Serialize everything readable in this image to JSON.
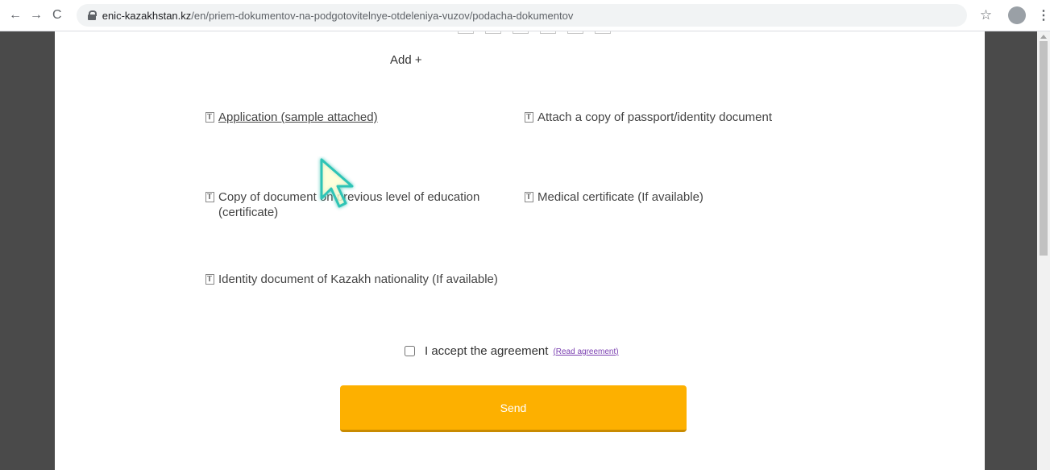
{
  "browser": {
    "back_icon": "arrow-left-icon",
    "forward_icon": "arrow-right-icon",
    "reload_icon": "reload-icon",
    "back_glyph": "←",
    "forward_glyph": "→",
    "reload_glyph": "C",
    "url_host": "enic-kazakhstan.kz",
    "url_path": "/en/priem-dokumentov-na-podgotovitelnye-otdeleniya-vuzov/podacha-dokumentov",
    "star_glyph": "☆",
    "menu_glyph": "⋮"
  },
  "form": {
    "add_more": "Add +",
    "documents": [
      {
        "label": "Application (sample attached)",
        "link": true
      },
      {
        "label": "Attach a copy of passport/identity document",
        "link": false
      },
      {
        "label": "Copy of document on previous level of education (certificate)",
        "link": false
      },
      {
        "label": "Medical certificate (If available)",
        "link": false
      },
      {
        "label": "Identity document of Kazakh nationality (If available)",
        "link": false
      }
    ],
    "agreement_label": "I accept the agreement",
    "agreement_link": "(Read agreement)",
    "agreement_checked": false,
    "send_label": "Send"
  },
  "colors": {
    "send_button": "#fdb000",
    "agreement_link": "#7a3fb0",
    "cursor": "#2ec4b6"
  }
}
